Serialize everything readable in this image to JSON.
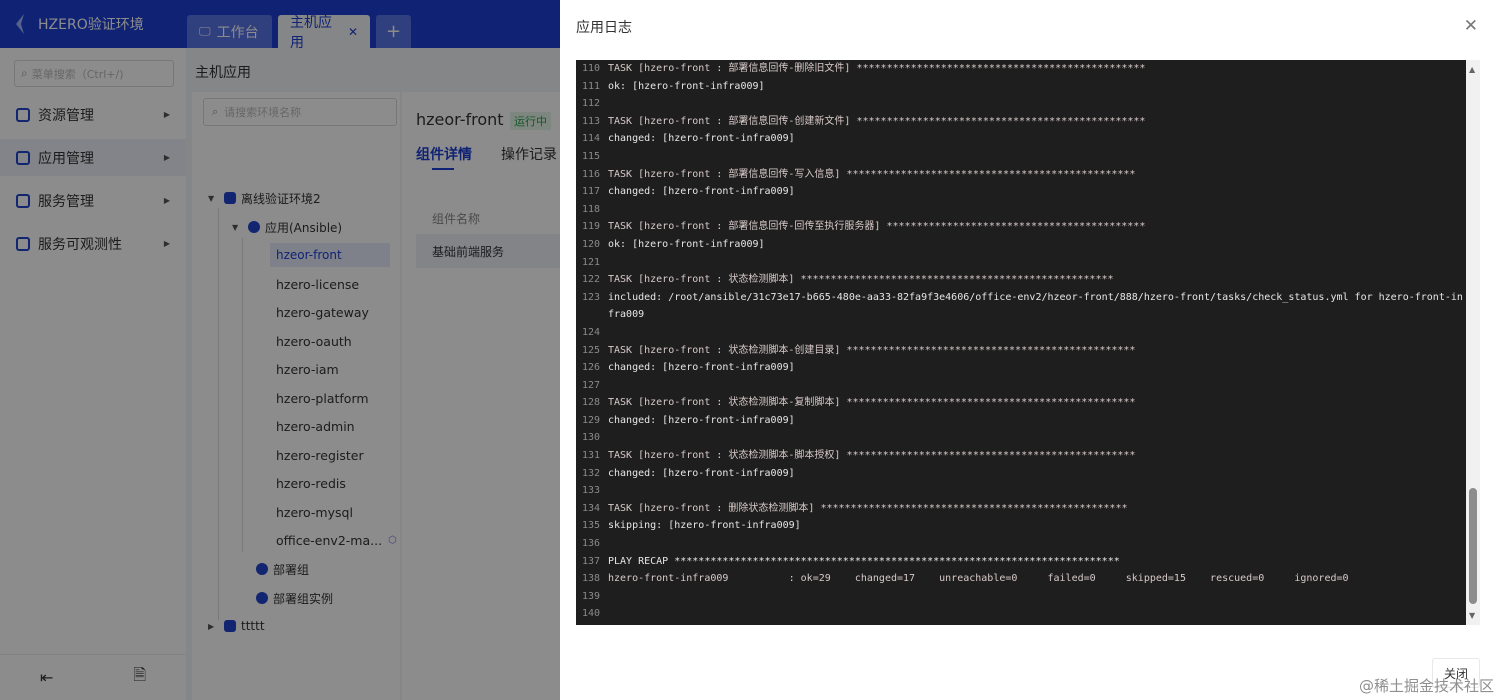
{
  "app": {
    "brand": "HZERO验证环境",
    "tabs": [
      {
        "label": "工作台",
        "icon": "monitor-icon"
      },
      {
        "label": "主机应用",
        "icon": "close-icon"
      },
      {
        "label": "+"
      }
    ],
    "menu_search_placeholder": "菜单搜索（Ctrl+/)",
    "menu": [
      {
        "label": "资源管理"
      },
      {
        "label": "应用管理"
      },
      {
        "label": "服务管理"
      },
      {
        "label": "服务可观测性"
      }
    ],
    "page_title": "主机应用",
    "tree_search_placeholder": "请搜索环境名称",
    "tree": {
      "env": "离线验证环境2",
      "app_group": "应用(Ansible)",
      "leaves": [
        "hzeor-front",
        "hzero-license",
        "hzero-gateway",
        "hzero-oauth",
        "hzero-iam",
        "hzero-platform",
        "hzero-admin",
        "hzero-register",
        "hzero-redis",
        "hzero-mysql",
        "office-env2-ma..."
      ],
      "deploy_group": "部署组",
      "deploy_instance": "部署组实例",
      "other_env": "ttttt"
    },
    "detail": {
      "title": "hzeor-front",
      "status": "运行中",
      "tabs": [
        "组件详情",
        "操作记录"
      ],
      "column": "组件名称",
      "row": "基础前端服务"
    }
  },
  "drawer": {
    "title": "应用日志",
    "close_label": "关闭",
    "log": [
      {
        "n": "110",
        "t": "TASK [hzero-front : 部署信息回传-删除旧文件] ************************************************",
        "task": true
      },
      {
        "n": "111",
        "t": "ok: [hzero-front-infra009]"
      },
      {
        "n": "112",
        "t": ""
      },
      {
        "n": "113",
        "t": "TASK [hzero-front : 部署信息回传-创建新文件] ************************************************",
        "task": true
      },
      {
        "n": "114",
        "t": "changed: [hzero-front-infra009]"
      },
      {
        "n": "115",
        "t": ""
      },
      {
        "n": "116",
        "t": "TASK [hzero-front : 部署信息回传-写入信息] ************************************************",
        "task": true
      },
      {
        "n": "117",
        "t": "changed: [hzero-front-infra009]"
      },
      {
        "n": "118",
        "t": ""
      },
      {
        "n": "119",
        "t": "TASK [hzero-front : 部署信息回传-回传至执行服务器] *******************************************",
        "task": true
      },
      {
        "n": "120",
        "t": "ok: [hzero-front-infra009]"
      },
      {
        "n": "121",
        "t": ""
      },
      {
        "n": "122",
        "t": "TASK [hzero-front : 状态检测脚本] ****************************************************",
        "task": true
      },
      {
        "n": "123",
        "t": "included: /root/ansible/31c73e17-b665-480e-aa33-82fa9f3e4606/office-env2/hzeor-front/888/hzero-front/tasks/check_status.yml for hzero-front-infra009",
        "wrap": true
      },
      {
        "n": "124",
        "t": ""
      },
      {
        "n": "125",
        "t": "TASK [hzero-front : 状态检测脚本-创建目录] ************************************************",
        "task": true
      },
      {
        "n": "126",
        "t": "changed: [hzero-front-infra009]"
      },
      {
        "n": "127",
        "t": ""
      },
      {
        "n": "128",
        "t": "TASK [hzero-front : 状态检测脚本-复制脚本] ************************************************",
        "task": true
      },
      {
        "n": "129",
        "t": "changed: [hzero-front-infra009]"
      },
      {
        "n": "130",
        "t": ""
      },
      {
        "n": "131",
        "t": "TASK [hzero-front : 状态检测脚本-脚本授权] ************************************************",
        "task": true
      },
      {
        "n": "132",
        "t": "changed: [hzero-front-infra009]"
      },
      {
        "n": "133",
        "t": ""
      },
      {
        "n": "134",
        "t": "TASK [hzero-front : 删除状态检测脚本] ***************************************************",
        "task": true
      },
      {
        "n": "135",
        "t": "skipping: [hzero-front-infra009]"
      },
      {
        "n": "136",
        "t": ""
      },
      {
        "n": "137",
        "t": "PLAY RECAP **************************************************************************"
      },
      {
        "n": "138",
        "t": "hzero-front-infra009          : ok=29    changed=17    unreachable=0     failed=0     skipped=15    rescued=0     ignored=0",
        "recap": true
      },
      {
        "n": "139",
        "t": ""
      },
      {
        "n": "140",
        "t": ""
      }
    ]
  },
  "watermark": "@稀土掘金技术社区"
}
